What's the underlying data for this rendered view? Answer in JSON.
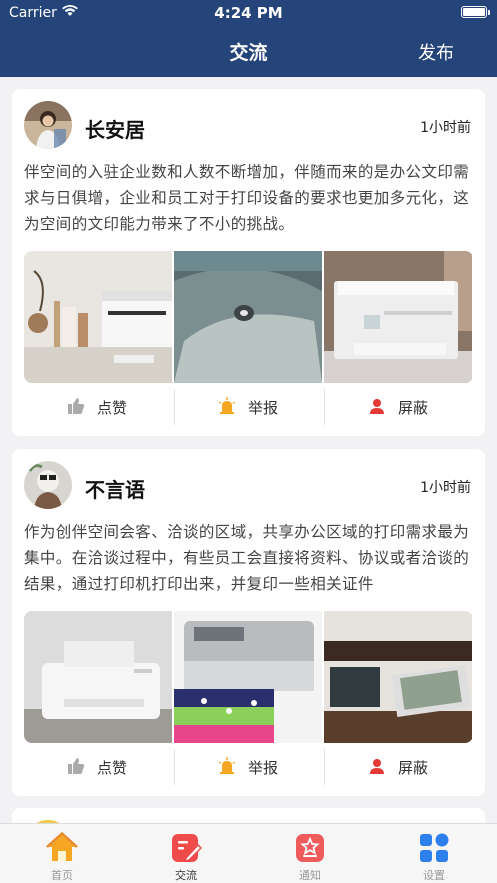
{
  "status_bar": {
    "carrier": "Carrier",
    "time": "4:24 PM"
  },
  "nav": {
    "title": "交流",
    "publish": "发布"
  },
  "posts": [
    {
      "username": "长安居",
      "time_ago": "1小时前",
      "content": "伴空间的入驻企业数和人数不断增加，伴随而来的是办公文印需求与日俱增，企业和员工对于打印设备的要求也更加多元化，这为空间的文印能力带来了不小的挑战。",
      "actions": {
        "like": "点赞",
        "report": "举报",
        "block": "屏蔽"
      }
    },
    {
      "username": "不言语",
      "time_ago": "1小时前",
      "content": "作为创伴空间会客、洽谈的区域，共享办公区域的打印需求最为集中。在洽谈过程中，有些员工会直接将资料、协议或者洽谈的结果，通过打印机打印出来，并复印一些相关证件",
      "actions": {
        "like": "点赞",
        "report": "举报",
        "block": "屏蔽"
      }
    }
  ],
  "tabbar": [
    {
      "label": "首页",
      "icon": "home-icon"
    },
    {
      "label": "交流",
      "icon": "edit-icon"
    },
    {
      "label": "通知",
      "icon": "notice-icon"
    },
    {
      "label": "设置",
      "icon": "grid-icon"
    }
  ],
  "colors": {
    "header": "#25447a",
    "accent_orange": "#f5a623",
    "accent_red": "#e53935",
    "tab_blue": "#2f80ed"
  }
}
